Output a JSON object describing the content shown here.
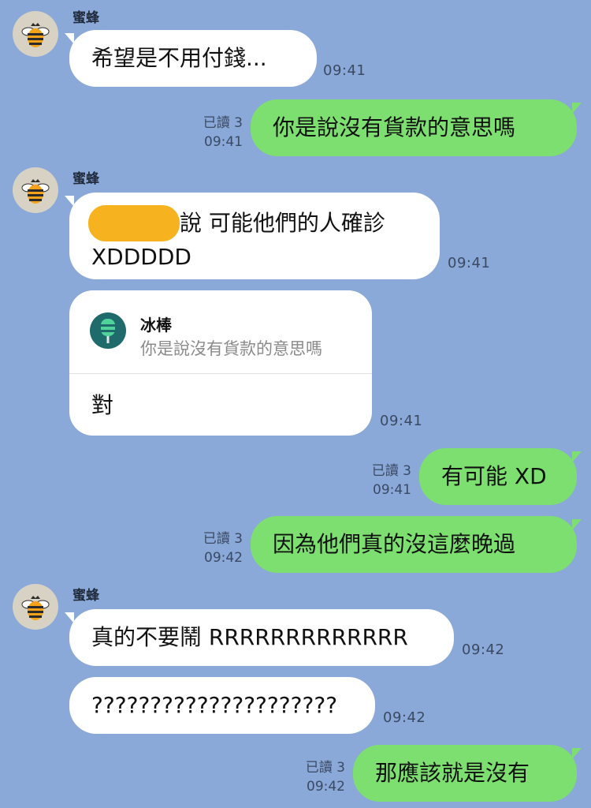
{
  "contact": {
    "name": "蜜蜂"
  },
  "messages": {
    "m1": {
      "text": "希望是不用付錢...",
      "time": "09:41"
    },
    "m2": {
      "read": "已讀 3",
      "time": "09:41",
      "text": "你是說沒有貨款的意思嗎"
    },
    "m3": {
      "line1": "說  可能他們的人確診",
      "line2": "XDDDDD",
      "time": "09:41"
    },
    "m4": {
      "reply_name": "冰棒",
      "reply_quote": "你是說沒有貨款的意思嗎",
      "text": "對",
      "time": "09:41"
    },
    "m5": {
      "read": "已讀 3",
      "time": "09:41",
      "text": "有可能 XD"
    },
    "m6": {
      "read": "已讀 3",
      "time": "09:42",
      "text": "因為他們真的沒這麼晚過"
    },
    "m7": {
      "text": "真的不要鬧 RRRRRRRRRRRRR",
      "time": "09:42"
    },
    "m8": {
      "text": "?????????????????????",
      "time": "09:42"
    },
    "m9": {
      "read": "已讀 3",
      "time": "09:42",
      "text": "那應該就是沒有"
    }
  },
  "colors": {
    "background": "#8aa8d8",
    "incoming_bubble": "#ffffff",
    "outgoing_bubble": "#7ddf6f",
    "redaction": "#f6b31f",
    "reply_avatar": "#1f6a6a"
  },
  "icons": {
    "contact_avatar": "bee-icon",
    "reply_avatar": "popsicle-icon"
  }
}
